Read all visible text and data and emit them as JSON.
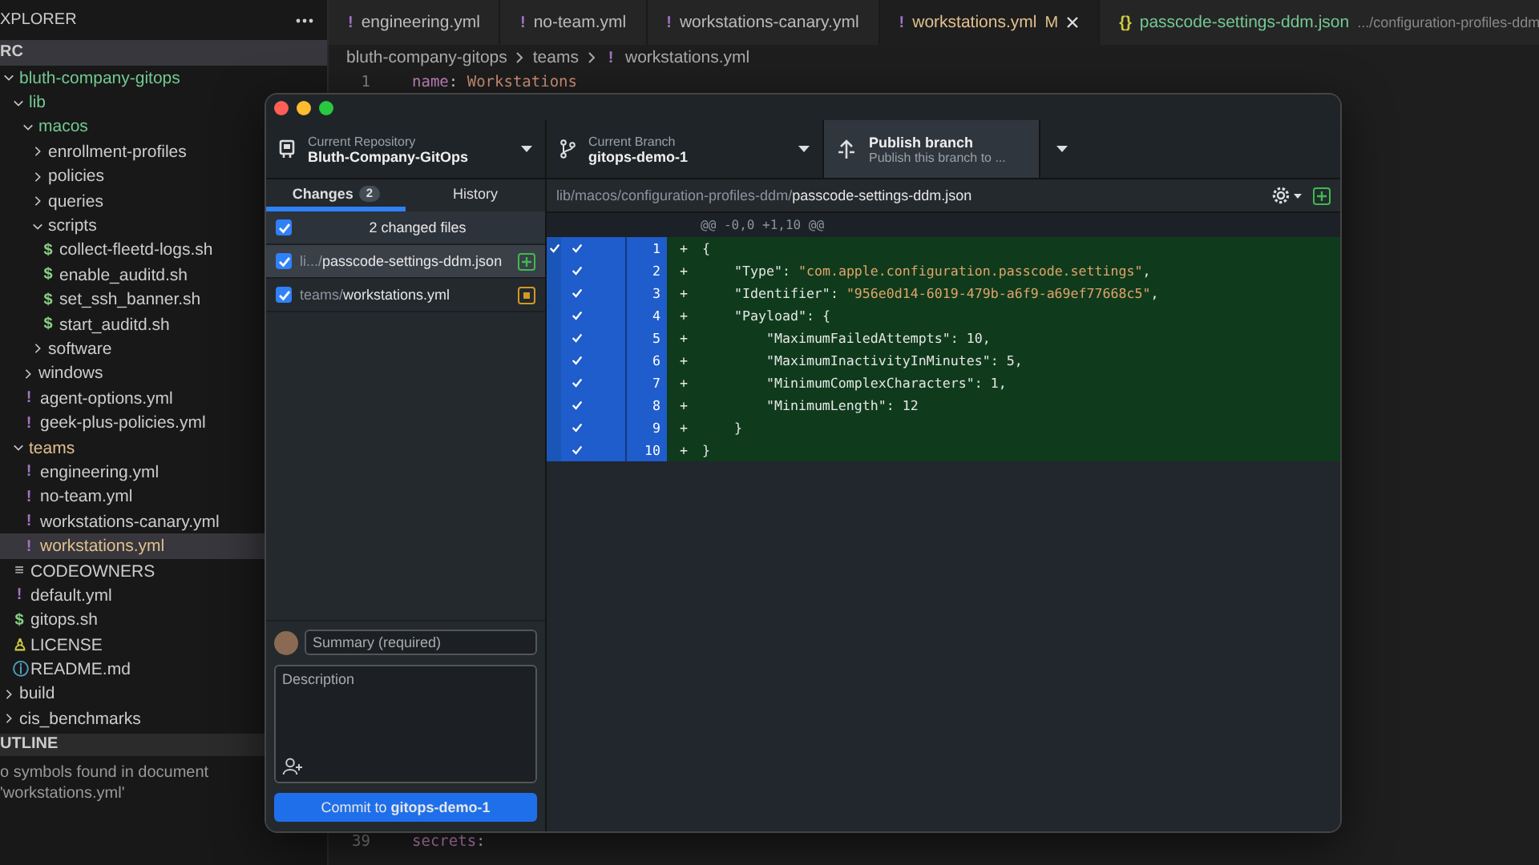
{
  "explorer": {
    "title": "XPLORER",
    "section": "RC",
    "tree": [
      {
        "label": "bluth-company-gitops",
        "kind": "folder",
        "expanded": true,
        "color": "#73c991",
        "selected": false,
        "children": [
          {
            "label": "lib",
            "kind": "folder",
            "expanded": true,
            "color": "#73c991",
            "selected": false,
            "children": [
              {
                "label": "macos",
                "kind": "folder",
                "expanded": true,
                "color": "#73c991",
                "selected": false,
                "children": [
                  {
                    "label": "enrollment-profiles",
                    "kind": "folder",
                    "expanded": false,
                    "selected": false
                  },
                  {
                    "label": "policies",
                    "kind": "folder",
                    "expanded": false,
                    "selected": false
                  },
                  {
                    "label": "queries",
                    "kind": "folder",
                    "expanded": false,
                    "selected": false
                  },
                  {
                    "label": "scripts",
                    "kind": "folder",
                    "expanded": true,
                    "selected": false,
                    "children": [
                      {
                        "label": "collect-fleetd-logs.sh",
                        "kind": "shell",
                        "icon": "$",
                        "selected": false
                      },
                      {
                        "label": "enable_auditd.sh",
                        "kind": "shell",
                        "icon": "$",
                        "selected": false
                      },
                      {
                        "label": "set_ssh_banner.sh",
                        "kind": "shell",
                        "icon": "$",
                        "selected": false
                      },
                      {
                        "label": "start_auditd.sh",
                        "kind": "shell",
                        "icon": "$",
                        "selected": false
                      }
                    ]
                  },
                  {
                    "label": "software",
                    "kind": "folder",
                    "expanded": false,
                    "selected": false
                  }
                ]
              },
              {
                "label": "windows",
                "kind": "folder",
                "expanded": false,
                "selected": false
              },
              {
                "label": "agent-options.yml",
                "kind": "yaml",
                "icon": "!",
                "selected": false
              },
              {
                "label": "geek-plus-policies.yml",
                "kind": "yaml",
                "icon": "!",
                "selected": false
              }
            ]
          },
          {
            "label": "teams",
            "kind": "folder",
            "expanded": true,
            "color": "#e2c08d",
            "selected": false,
            "children": [
              {
                "label": "engineering.yml",
                "kind": "yaml",
                "icon": "!",
                "selected": false
              },
              {
                "label": "no-team.yml",
                "kind": "yaml",
                "icon": "!",
                "selected": false
              },
              {
                "label": "workstations-canary.yml",
                "kind": "yaml",
                "icon": "!",
                "selected": false
              },
              {
                "label": "workstations.yml",
                "kind": "yaml",
                "icon": "!",
                "color": "#e2c08d",
                "selected": true
              }
            ]
          },
          {
            "label": "CODEOWNERS",
            "kind": "text",
            "icon": "≡",
            "selected": false
          },
          {
            "label": "default.yml",
            "kind": "yaml",
            "icon": "!",
            "selected": false
          },
          {
            "label": "gitops.sh",
            "kind": "shell",
            "icon": "$",
            "selected": false
          },
          {
            "label": "LICENSE",
            "kind": "license",
            "icon": "♙",
            "selected": false
          },
          {
            "label": "README.md",
            "kind": "markdown",
            "icon": "ⓘ",
            "selected": false
          }
        ]
      },
      {
        "label": "build",
        "kind": "folder",
        "expanded": false,
        "selected": false
      },
      {
        "label": "cis_benchmarks",
        "kind": "folder",
        "expanded": false,
        "selected": false
      }
    ]
  },
  "outline": {
    "title": "UTLINE",
    "message": "o symbols found in document 'workstations.yml'"
  },
  "editor_tabs": [
    {
      "label": "engineering.yml",
      "kind": "yaml",
      "icon": "!",
      "selected": false
    },
    {
      "label": "no-team.yml",
      "kind": "yaml",
      "icon": "!",
      "selected": false
    },
    {
      "label": "workstations-canary.yml",
      "kind": "yaml",
      "icon": "!",
      "selected": false
    },
    {
      "label": "workstations.yml",
      "kind": "yaml",
      "icon": "!",
      "selected": true,
      "color": "#e2c08d",
      "badge": "M"
    },
    {
      "label": "passcode-settings-ddm.json",
      "kind": "json",
      "icon": "{}",
      "selected": false,
      "color": "#73c991",
      "description": ".../configuration-profiles-ddm"
    }
  ],
  "breadcrumb": [
    {
      "label": "bluth-company-gitops"
    },
    {
      "label": "teams"
    },
    {
      "label": "workstations.yml",
      "icon": "!"
    }
  ],
  "code_top": [
    {
      "number": "1",
      "text": "name: Workstations"
    }
  ],
  "code_bottom": [
    {
      "number": "39",
      "text": "secrets:"
    }
  ],
  "desktop": {
    "repository": {
      "label": "Current Repository",
      "value": "Bluth-Company-GitOps"
    },
    "branch": {
      "label": "Current Branch",
      "value": "gitops-demo-1"
    },
    "publish": {
      "label": "Publish branch",
      "description": "Publish this branch to ..."
    },
    "tabs": [
      {
        "label": "Changes",
        "badge": "2",
        "selected": true
      },
      {
        "label": "History",
        "selected": false
      }
    ],
    "select_all": {
      "label": "2 changed files",
      "checked": true
    },
    "files": [
      {
        "dir": "li.../",
        "name": "passcode-settings-ddm.json",
        "checked": true,
        "selected": true,
        "kind": "added"
      },
      {
        "dir": "teams/",
        "name": "workstations.yml",
        "checked": true,
        "selected": false,
        "kind": "modified"
      }
    ],
    "diff": {
      "dir": "lib/macos/configuration-profiles-ddm/",
      "file": "passcode-settings-ddm.json",
      "hunk": "@@ -0,0 +1,10 @@",
      "hunk_checked": true,
      "lines": [
        {
          "number": "1",
          "sign": "+",
          "code": "{",
          "checked": true
        },
        {
          "number": "2",
          "sign": "+",
          "code": "    \"Type\": \"com.apple.configuration.passcode.settings\",",
          "checked": true
        },
        {
          "number": "3",
          "sign": "+",
          "code": "    \"Identifier\": \"956e0d14-6019-479b-a6f9-a69ef77668c5\",",
          "checked": true
        },
        {
          "number": "4",
          "sign": "+",
          "code": "    \"Payload\": {",
          "checked": true
        },
        {
          "number": "5",
          "sign": "+",
          "code": "        \"MaximumFailedAttempts\": 10,",
          "checked": true
        },
        {
          "number": "6",
          "sign": "+",
          "code": "        \"MaximumInactivityInMinutes\": 5,",
          "checked": true
        },
        {
          "number": "7",
          "sign": "+",
          "code": "        \"MinimumComplexCharacters\": 1,",
          "checked": true
        },
        {
          "number": "8",
          "sign": "+",
          "code": "        \"MinimumLength\": 12",
          "checked": true
        },
        {
          "number": "9",
          "sign": "+",
          "code": "    }",
          "checked": true
        },
        {
          "number": "10",
          "sign": "+",
          "code": "}",
          "checked": true
        }
      ]
    },
    "commit": {
      "summary_placeholder": "Summary (required)",
      "description_placeholder": "Description",
      "button": "Commit to **gitops-demo-1**"
    }
  }
}
